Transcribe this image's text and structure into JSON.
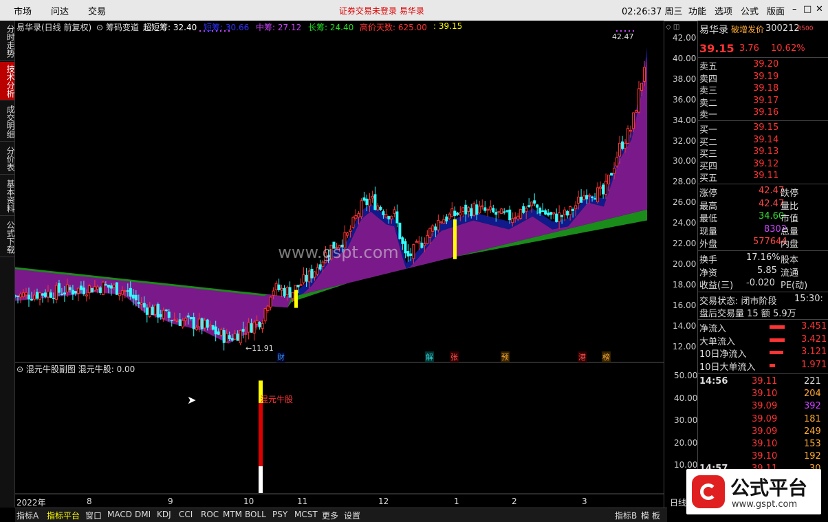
{
  "topbar": {
    "menus": [
      "市场",
      "问达",
      "交易"
    ],
    "trade_status": "证券交易未登录  易华录",
    "clock": "02:26:37 周三",
    "right_tabs": [
      "功能",
      "选项",
      "公式",
      "版面"
    ],
    "win_controls": [
      "–",
      "□",
      "✕"
    ]
  },
  "left_tabs": [
    {
      "label": "分时走势",
      "active": false
    },
    {
      "label": "技术分析",
      "active": true
    },
    {
      "label": "成交明细",
      "active": false
    },
    {
      "label": "分价表",
      "active": false
    },
    {
      "label": "基本资料",
      "active": false
    },
    {
      "label": "公式下载",
      "active": false
    }
  ],
  "main_chart": {
    "title": "易华录(日线 前复权)",
    "indicator": "筹码变道",
    "legend": [
      {
        "label": "超短筹: 32.40",
        "color": "#ffffff"
      },
      {
        "label": "短筹: 30.66",
        "color": "#3030ff"
      },
      {
        "label": "中筹: 27.12",
        "color": "#cc44ff"
      },
      {
        "label": "长筹: 24.40",
        "color": "#22dd22"
      },
      {
        "label": "高价天数: 625.00",
        "color": "#ff3333"
      },
      {
        "label": ": 39.15",
        "color": "#ffff00"
      }
    ],
    "high_label": "42.47",
    "low_label": "←11.91",
    "y_ticks": [
      "42.00",
      "40.00",
      "38.00",
      "36.00",
      "34.00",
      "32.00",
      "30.00",
      "28.00",
      "26.00",
      "24.00",
      "22.00",
      "20.00",
      "18.00",
      "16.00",
      "14.00",
      "12.00"
    ],
    "watermark": "www.gspt.com",
    "event_markers": [
      {
        "label": "财",
        "color": "#3399ff"
      },
      {
        "label": "解",
        "color": "#33cccc"
      },
      {
        "label": "张",
        "color": "#ff5555"
      },
      {
        "label": "预",
        "color": "#ffaa33"
      },
      {
        "label": "港",
        "color": "#ff5555"
      },
      {
        "label": "榜",
        "color": "#ffaa33"
      }
    ]
  },
  "sub_chart": {
    "title": "混元牛股副图",
    "value_label": "混元牛股: 0.00",
    "bar_label": "混元牛股",
    "y_ticks": [
      "50.00",
      "40.00",
      "30.00",
      "20.00",
      "10.00"
    ]
  },
  "x_axis": [
    "2022年",
    "8",
    "9",
    "10",
    "11",
    "12",
    "1",
    "2",
    "3"
  ],
  "x_axis_right": "日线",
  "quote": {
    "name": "易华录",
    "tag": "破增发价",
    "code": "300212",
    "r_tag": "R500",
    "price": "39.15",
    "change": "3.76",
    "pct": "10.62%",
    "asks": [
      {
        "label": "卖五",
        "price": "39.20"
      },
      {
        "label": "卖四",
        "price": "39.19"
      },
      {
        "label": "卖三",
        "price": "39.18"
      },
      {
        "label": "卖二",
        "price": "39.17"
      },
      {
        "label": "卖一",
        "price": "39.16"
      }
    ],
    "bids": [
      {
        "label": "买一",
        "price": "39.15"
      },
      {
        "label": "买二",
        "price": "39.14"
      },
      {
        "label": "买三",
        "price": "39.13"
      },
      {
        "label": "买四",
        "price": "39.12"
      },
      {
        "label": "买五",
        "price": "39.11"
      }
    ],
    "stats": [
      {
        "l": "涨停",
        "v": "42.47",
        "r": "跌停",
        "vc": "#ff4444"
      },
      {
        "l": "最高",
        "v": "42.47",
        "r": "量比",
        "vc": "#ff4444"
      },
      {
        "l": "最低",
        "v": "34.60",
        "r": "市值",
        "vc": "#33dd33"
      },
      {
        "l": "现量",
        "v": "8302",
        "r": "总量",
        "vc": "#cc44ff"
      },
      {
        "l": "外盘",
        "v": "577644",
        "r": "内盘",
        "vc": "#ff4444"
      }
    ],
    "stats2": [
      {
        "l": "换手",
        "v": "17.16%",
        "r": "股本"
      },
      {
        "l": "净资",
        "v": "5.85",
        "r": "流通"
      },
      {
        "l": "收益(三)",
        "v": "-0.020",
        "r": "PE(动)"
      }
    ],
    "trade_state": "交易状态: 闭市阶段",
    "trade_state_time": "15:30:",
    "after_hours": "盘后交易量 15 额 5.9万",
    "flows": [
      {
        "l": "净流入",
        "v": "3.451"
      },
      {
        "l": "大单流入",
        "v": "3.421"
      },
      {
        "l": "10日净流入",
        "v": "3.121"
      },
      {
        "l": "10日大单流入",
        "v": "1.971"
      }
    ],
    "ticks": [
      {
        "t": "14:56",
        "p": "39.11",
        "v": "221",
        "vc": "#dddddd"
      },
      {
        "t": "",
        "p": "39.10",
        "v": "204",
        "vc": "#ffaa33"
      },
      {
        "t": "",
        "p": "39.09",
        "v": "392",
        "vc": "#cc44ff"
      },
      {
        "t": "",
        "p": "39.09",
        "v": "181",
        "vc": "#ffaa33"
      },
      {
        "t": "",
        "p": "39.09",
        "v": "249",
        "vc": "#ffaa33"
      },
      {
        "t": "",
        "p": "39.10",
        "v": "153",
        "vc": "#ffaa33"
      },
      {
        "t": "",
        "p": "39.10",
        "v": "192",
        "vc": "#ffaa33"
      },
      {
        "t": "14:57",
        "p": "39.11",
        "v": "30",
        "vc": "#ffaa33"
      }
    ]
  },
  "bottom_tabs": [
    {
      "label": "指标A",
      "active": false
    },
    {
      "label": "指标平台",
      "active": true
    },
    {
      "label": "窗口",
      "active": false
    },
    {
      "label": "MACD",
      "active": false
    },
    {
      "label": "DMI",
      "active": false
    },
    {
      "label": "KDJ",
      "active": false
    },
    {
      "label": "CCI",
      "active": false
    },
    {
      "label": "ROC",
      "active": false
    },
    {
      "label": "MTM",
      "active": false
    },
    {
      "label": "BOLL",
      "active": false
    },
    {
      "label": "PSY",
      "active": false
    },
    {
      "label": "MCST",
      "active": false
    },
    {
      "label": "更多",
      "active": false
    },
    {
      "label": "设置",
      "active": false
    }
  ],
  "bottom_right_tabs": [
    "指标B",
    "模",
    "板"
  ],
  "logo": {
    "text": "公式平台",
    "url": "www.gspt.com"
  },
  "colors": {
    "up": "#ff3333",
    "down": "#33ffff",
    "long": "#1a8c1a",
    "mid": "#7a1a8a",
    "short": "#101a8a",
    "accent": "#ffff00"
  }
}
